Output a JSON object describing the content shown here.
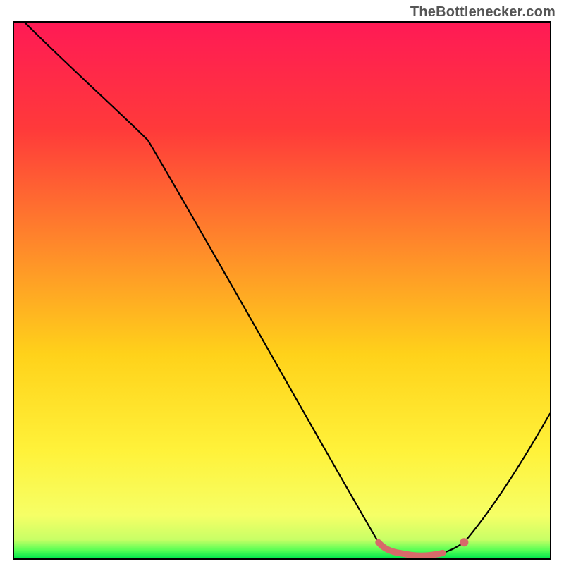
{
  "watermark": "TheBottlenecker.com",
  "chart_data": {
    "type": "line",
    "title": "",
    "xlabel": "",
    "ylabel": "",
    "xlim": [
      0,
      100
    ],
    "ylim": [
      0,
      100
    ],
    "series": [
      {
        "name": "curve",
        "x": [
          2,
          25,
          68,
          72,
          76,
          80,
          84,
          100
        ],
        "y": [
          100,
          78,
          3,
          1,
          0.5,
          1,
          3,
          27
        ]
      }
    ],
    "highlight": {
      "name": "highlight-segment",
      "color": "#d76a6a",
      "x": [
        68,
        72,
        76,
        80,
        84
      ],
      "y": [
        3,
        1,
        0.5,
        1,
        3
      ]
    },
    "gradient_stops": [
      {
        "offset": 0.0,
        "color": "#ff1a55"
      },
      {
        "offset": 0.2,
        "color": "#ff3a3a"
      },
      {
        "offset": 0.42,
        "color": "#ff8a2a"
      },
      {
        "offset": 0.62,
        "color": "#ffd21a"
      },
      {
        "offset": 0.8,
        "color": "#fff23a"
      },
      {
        "offset": 0.92,
        "color": "#f6ff66"
      },
      {
        "offset": 0.965,
        "color": "#c8ff66"
      },
      {
        "offset": 0.985,
        "color": "#55ff55"
      },
      {
        "offset": 1.0,
        "color": "#00e64d"
      }
    ]
  }
}
